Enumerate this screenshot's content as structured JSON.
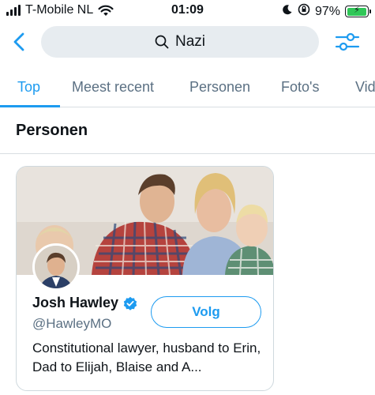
{
  "status_bar": {
    "carrier": "T-Mobile NL",
    "time": "01:09",
    "battery_percent": "97%",
    "battery_level": 0.97,
    "icons": [
      "signal-icon",
      "wifi-icon",
      "moon-icon",
      "orientation-lock-icon",
      "battery-icon"
    ]
  },
  "search": {
    "query": "Nazi",
    "icons": [
      "back-arrow-icon",
      "search-icon",
      "filter-icon"
    ]
  },
  "tabs": [
    {
      "label": "Top",
      "active": true
    },
    {
      "label": "Meest recent",
      "active": false
    },
    {
      "label": "Personen",
      "active": false
    },
    {
      "label": "Foto's",
      "active": false
    },
    {
      "label": "Vid",
      "active": false
    }
  ],
  "section": {
    "title": "Personen"
  },
  "person_card": {
    "name": "Josh Hawley",
    "handle": "@HawleyMO",
    "verified": true,
    "follow_label": "Volg",
    "bio": "Constitutional lawyer, husband to Erin, Dad to Elijah, Blaise and A..."
  },
  "colors": {
    "accent": "#1d9bf0",
    "muted_text": "#5b7083",
    "search_bg": "#e7ecf0",
    "battery_green": "#30c758"
  }
}
